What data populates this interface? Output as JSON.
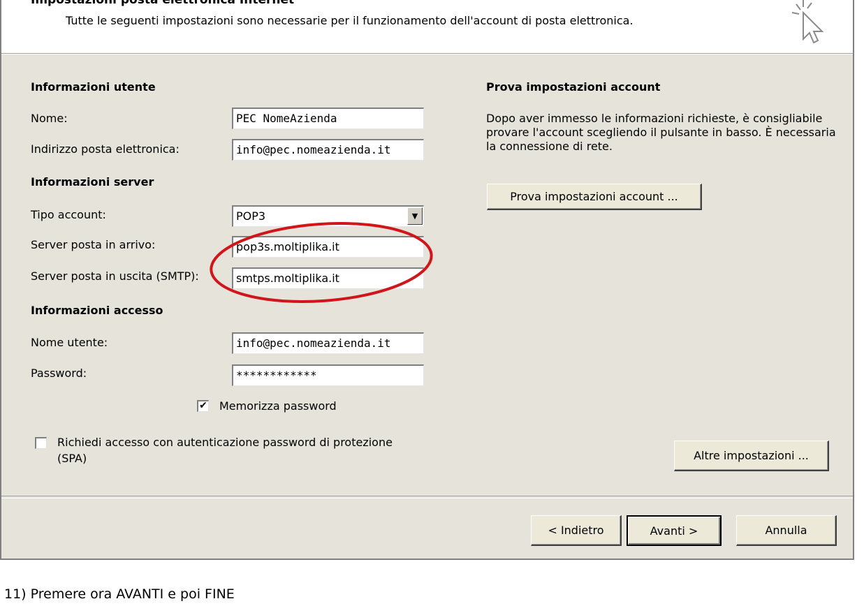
{
  "header": {
    "title": "Impostazioni posta elettronica Internet",
    "subtitle": "Tutte le seguenti impostazioni sono necessarie per il funzionamento dell'account di posta elettronica."
  },
  "user_info": {
    "heading": "Informazioni utente",
    "name_label": "Nome:",
    "name_value": "PEC NomeAzienda",
    "email_label": "Indirizzo posta elettronica:",
    "email_value": "info@pec.nomeazienda.it"
  },
  "server_info": {
    "heading": "Informazioni server",
    "account_type_label": "Tipo account:",
    "account_type_value": "POP3",
    "incoming_label": "Server posta in arrivo:",
    "incoming_value": "pop3s.moltiplika.it",
    "outgoing_label": "Server posta in uscita (SMTP):",
    "outgoing_value": "smtps.moltiplika.it"
  },
  "access_info": {
    "heading": "Informazioni accesso",
    "username_label": "Nome utente:",
    "username_value": "info@pec.nomeazienda.it",
    "password_label": "Password:",
    "password_value": "************",
    "remember_label": "Memorizza password",
    "remember_checked": true,
    "spa_label_line1": "Richiedi accesso con autenticazione password di protezione",
    "spa_label_line2": "(SPA)",
    "spa_checked": false
  },
  "test_panel": {
    "heading": "Prova impostazioni account",
    "description": "Dopo aver immesso le informazioni richieste, è consigliabile provare l'account scegliendo il pulsante in basso. È necessaria la connessione di rete.",
    "test_button": "Prova impostazioni account ...",
    "more_button": "Altre impostazioni ..."
  },
  "footer": {
    "back_button": "< Indietro",
    "next_button": "Avanti >",
    "cancel_button": "Annulla"
  },
  "caption": "11) Premere ora AVANTI e poi FINE",
  "colors": {
    "dialog_bg": "#e6e4da",
    "highlight_ellipse": "#d0151b"
  },
  "icons": {
    "header_icon": "cursor-click-icon",
    "select_arrow": "chevron-down-icon",
    "checkbox_mark": "checkmark-icon"
  }
}
